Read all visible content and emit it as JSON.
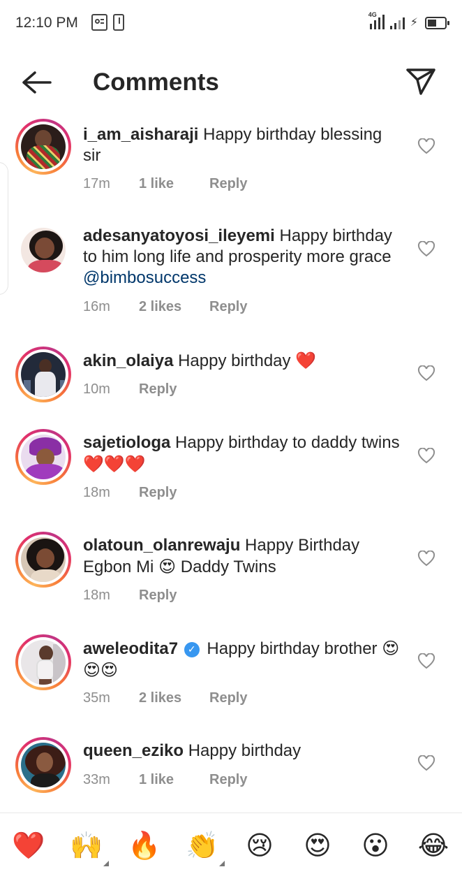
{
  "status_bar": {
    "time": "12:10 PM",
    "network": "4G"
  },
  "header": {
    "title": "Comments",
    "back_icon": "arrow-left-icon",
    "send_icon": "paper-plane-icon"
  },
  "comments": [
    {
      "username": "i_am_aisharaji",
      "text": "Happy birthday blessing sir",
      "time": "17m",
      "likes": "1 like",
      "reply": "Reply"
    },
    {
      "username": "adesanyatoyosi_ileyemi",
      "text": "Happy birthday to him long life and prosperity more grace",
      "mention": "@bimbosuccess",
      "time": "16m",
      "likes": "2 likes",
      "reply": "Reply"
    },
    {
      "username": "akin_olaiya",
      "text": "Happy birthday",
      "emoji": "❤️",
      "time": "10m",
      "reply": "Reply"
    },
    {
      "username": "sajetiologa",
      "text": "Happy birthday to daddy twins",
      "emoji": "❤️❤️❤️",
      "time": "18m",
      "reply": "Reply"
    },
    {
      "username": "olatoun_olanrewaju",
      "text_before": "Happy Birthday Egbon Mi",
      "emoji": "😍",
      "text_after": "Daddy Twins",
      "time": "18m",
      "reply": "Reply"
    },
    {
      "username": "aweleodita7",
      "verified": true,
      "text": "Happy birthday brother",
      "emoji": "😍😍😍",
      "time": "35m",
      "likes": "2 likes",
      "reply": "Reply"
    },
    {
      "username": "queen_eziko",
      "text": "Happy birthday",
      "time": "33m",
      "likes": "1 like",
      "reply": "Reply"
    }
  ],
  "reactions": [
    {
      "emoji": "❤️",
      "name": "red-heart"
    },
    {
      "emoji": "🙌",
      "name": "raising-hands"
    },
    {
      "emoji": "🔥",
      "name": "fire"
    },
    {
      "emoji": "👏",
      "name": "clapping-hands"
    },
    {
      "emoji": "😢",
      "name": "crying-face"
    },
    {
      "emoji": "😍",
      "name": "heart-eyes"
    },
    {
      "emoji": "😮",
      "name": "surprised-face"
    },
    {
      "emoji": "😂",
      "name": "tears-of-joy"
    }
  ],
  "colors": {
    "text": "#262626",
    "muted": "#8e8e8e",
    "mention": "#00376b",
    "verified": "#3897f0",
    "heart": "#ed4956"
  }
}
